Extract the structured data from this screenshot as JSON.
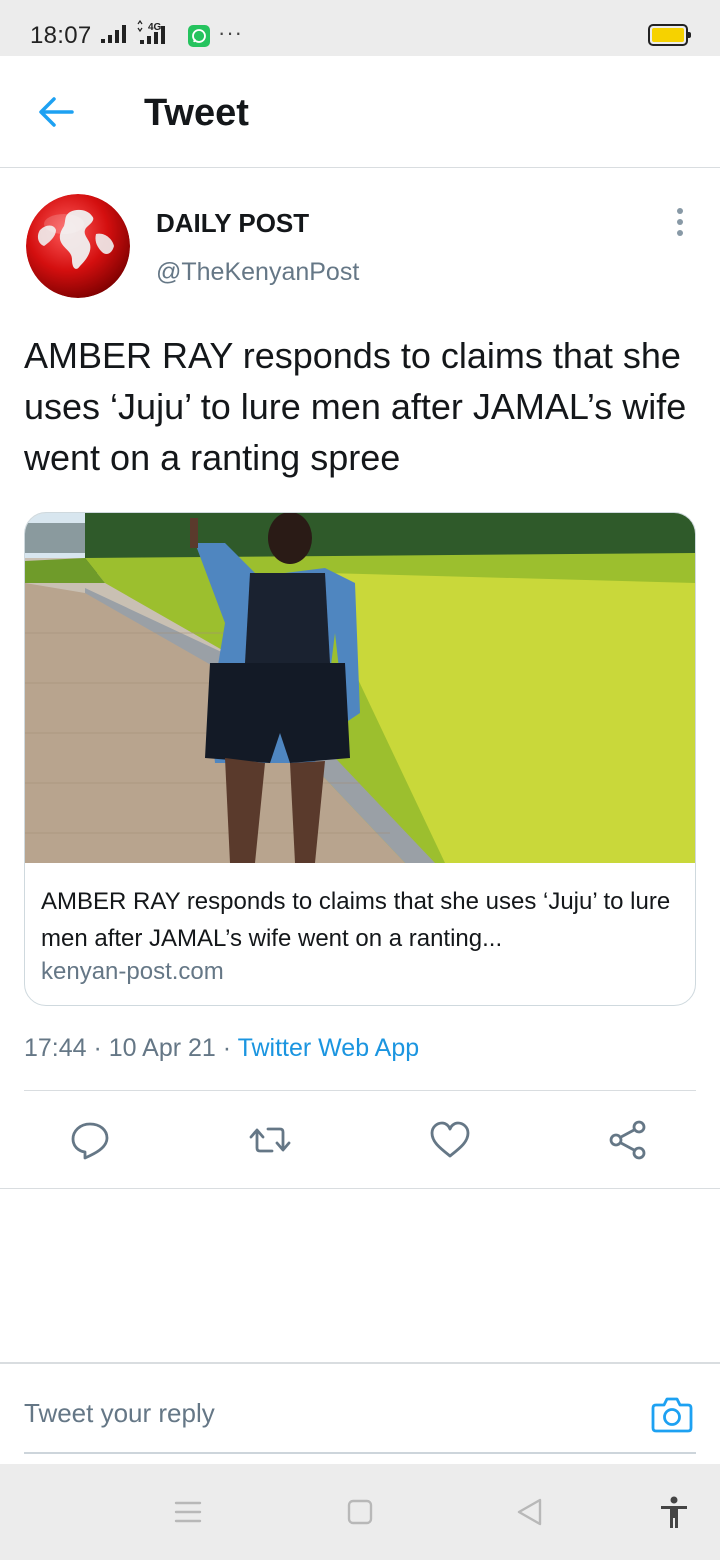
{
  "status_bar": {
    "time": "18:07",
    "network": "4G",
    "more": "···",
    "colors": {
      "whatsapp": "#25c35e",
      "battery": "#f6d200"
    }
  },
  "header": {
    "title": "Tweet",
    "back_icon": "arrow-left-icon"
  },
  "tweet": {
    "author_name": "DAILY POST",
    "author_handle": "@TheKenyanPost",
    "text": "AMBER RAY responds to claims that she uses ‘Juju’ to lure men after JAMAL’s wife went on a ranting spree",
    "card": {
      "title": "AMBER RAY responds to claims that she uses ‘Juju’ to lure men after JAMAL’s wife went on a ranting...",
      "domain": "kenyan-post.com"
    },
    "time": "17:44",
    "separator": " · ",
    "date": "10 Apr 21",
    "source": "Twitter Web App"
  },
  "actions": {
    "reply_icon": "comment-icon",
    "retweet_icon": "retweet-icon",
    "like_icon": "heart-icon",
    "share_icon": "share-icon"
  },
  "reply": {
    "placeholder": "Tweet your reply",
    "camera_icon": "camera-icon"
  },
  "nav": {
    "menu_icon": "menu-icon",
    "home_icon": "square-home-icon",
    "back_icon": "triangle-back-icon",
    "accessibility_icon": "accessibility-icon"
  },
  "colors": {
    "accent": "#1da1f2",
    "text_primary": "#14171a",
    "text_secondary": "#657786",
    "link": "#1b95e0"
  }
}
